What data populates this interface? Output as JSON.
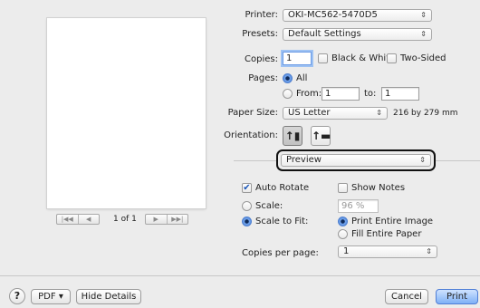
{
  "printer": {
    "label": "Printer:",
    "value": "OKI-MC562-5470D5"
  },
  "presets": {
    "label": "Presets:",
    "value": "Default Settings"
  },
  "copies": {
    "label": "Copies:",
    "value": "1",
    "black_white": "Black & White",
    "two_sided": "Two-Sided"
  },
  "pages": {
    "label": "Pages:",
    "all": "All",
    "from_label": "From:",
    "from_value": "1",
    "to_label": "to:",
    "to_value": "1"
  },
  "paper": {
    "label": "Paper Size:",
    "value": "US Letter",
    "dimensions": "216 by 279 mm"
  },
  "orientation": {
    "label": "Orientation:"
  },
  "section": {
    "value": "Preview"
  },
  "preview_opts": {
    "auto_rotate": "Auto Rotate",
    "show_notes": "Show Notes",
    "scale_label": "Scale:",
    "scale_value": "96 %",
    "scale_to_fit": "Scale to Fit:",
    "print_entire_image": "Print Entire Image",
    "fill_entire_paper": "Fill Entire Paper",
    "copies_per_page_label": "Copies per page:",
    "copies_per_page_value": "1"
  },
  "navigation": {
    "page_indicator": "1 of 1"
  },
  "buttons": {
    "help": "?",
    "pdf": "PDF ▾",
    "hide_details": "Hide Details",
    "cancel": "Cancel",
    "print": "Print"
  },
  "icons": {
    "popup_arrows": "⇕",
    "checkmark": "✔",
    "first": "|◀◀",
    "prev": "◀",
    "next": "▶",
    "last": "▶▶|"
  }
}
